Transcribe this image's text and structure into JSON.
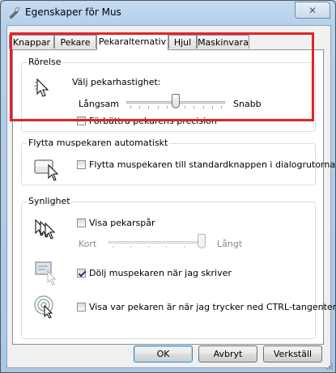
{
  "window": {
    "title": "Egenskaper för Mus",
    "close_glyph": "✕"
  },
  "tabs": [
    {
      "label": "Knappar"
    },
    {
      "label": "Pekare"
    },
    {
      "label": "Pekaralternativ"
    },
    {
      "label": "Hjul"
    },
    {
      "label": "Maskinvara"
    }
  ],
  "active_tab": "Pekaralternativ",
  "motion": {
    "group_title": "Rörelse",
    "speed_label": "Välj pekarhastighet:",
    "slow_label": "Långsam",
    "fast_label": "Snabb",
    "speed_fraction": 0.5,
    "precision_label": "Förbättra pekarens precision",
    "precision_checked": false
  },
  "snap_to": {
    "group_title": "Flytta muspekaren automatiskt",
    "option_label": "Flytta muspekaren till standardknappen i dialogrutorna",
    "checked": false
  },
  "visibility": {
    "group_title": "Synlighet",
    "trails_label": "Visa pekarspår",
    "trails_checked": false,
    "short_label": "Kort",
    "long_label": "Långt",
    "trails_fraction": 1.0,
    "hide_typing_label": "Dölj muspekaren när jag skriver",
    "hide_typing_checked": true,
    "show_ctrl_label": "Visa var pekaren är när jag trycker ned CTRL-tangenten",
    "show_ctrl_checked": false
  },
  "buttons": {
    "ok": "OK",
    "cancel": "Avbryt",
    "apply": "Verkställ"
  },
  "colors": {
    "highlight": "#e2232a",
    "title_bg": "#b4d0ea"
  }
}
